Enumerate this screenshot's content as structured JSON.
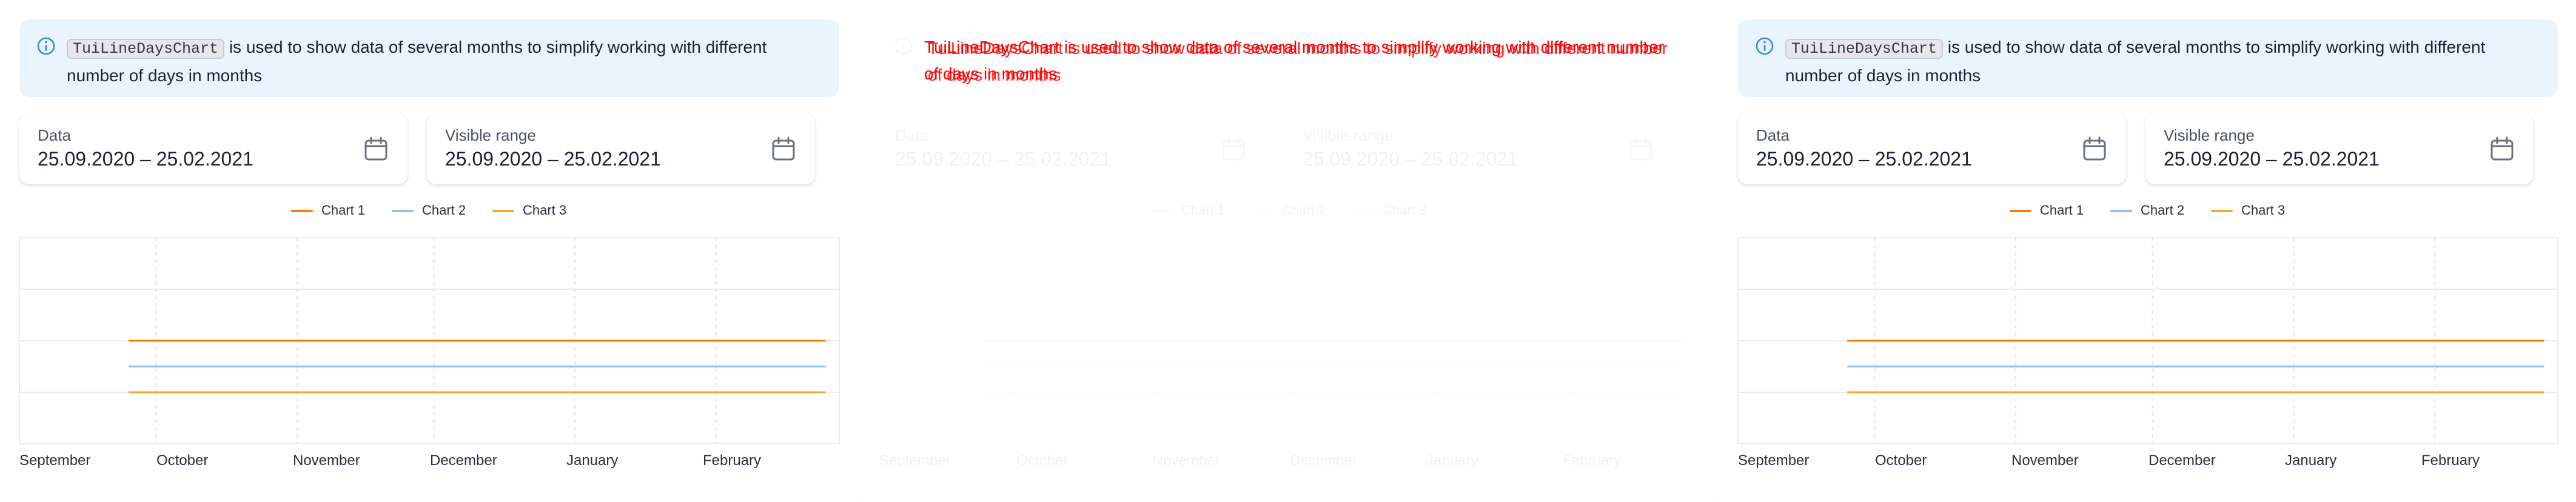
{
  "notification": {
    "code": "TuiLineDaysChart",
    "text": " is used to show data of several months to simplify working with different number of days in months"
  },
  "data_field": {
    "label": "Data",
    "value": "25.09.2020 – 25.02.2021"
  },
  "range_field": {
    "label": "Visible range",
    "value": "25.09.2020 – 25.02.2021"
  },
  "legend": [
    {
      "name": "Chart 1",
      "color": "#ff7a00"
    },
    {
      "name": "Chart 2",
      "color": "#8fbcf2"
    },
    {
      "name": "Chart 3",
      "color": "#f5a623"
    }
  ],
  "months": [
    "September",
    "October",
    "November",
    "December",
    "January",
    "February"
  ],
  "icons": {
    "info": "info-icon",
    "calendar": "calendar-icon"
  },
  "chart_data": {
    "type": "line",
    "x": [
      "2020-09-25",
      "2021-02-25"
    ],
    "x_tick_labels": [
      "September",
      "October",
      "November",
      "December",
      "January",
      "February"
    ],
    "series": [
      {
        "name": "Chart 1",
        "values": [
          3,
          3
        ],
        "color": "#ff7a00"
      },
      {
        "name": "Chart 2",
        "values": [
          2,
          2
        ],
        "color": "#8fbcf2"
      },
      {
        "name": "Chart 3",
        "values": [
          1,
          1
        ],
        "color": "#f5a623"
      }
    ],
    "ylim": [
      -1,
      7
    ],
    "grid": true,
    "legend_position": "top-center"
  }
}
